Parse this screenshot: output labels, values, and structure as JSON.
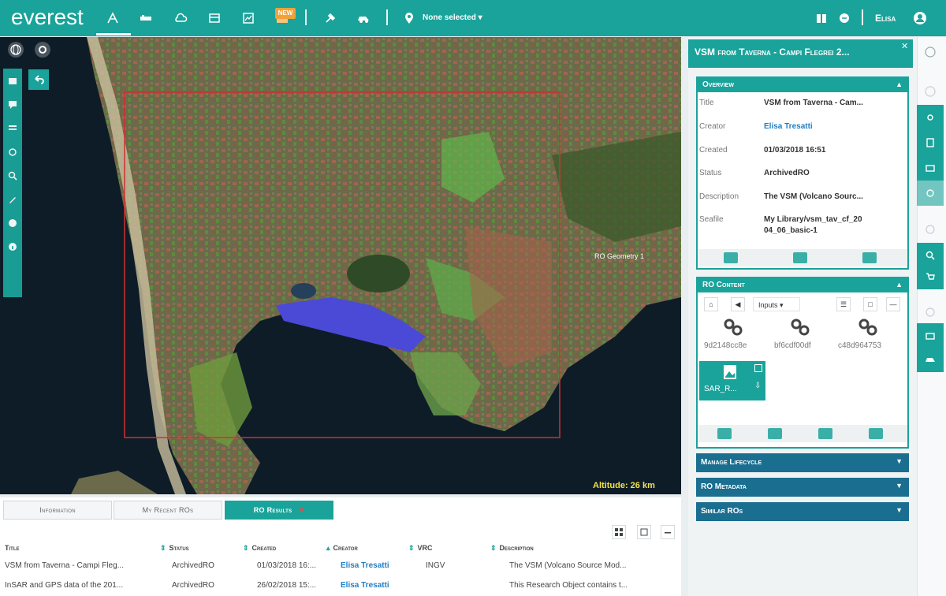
{
  "app": {
    "logo": "everest",
    "location_selector": "None selected",
    "user": "Elisa",
    "new_badge": "NEW"
  },
  "map": {
    "geometry_label": "RO Geometry 1",
    "altitude": "Altitude: 26 km"
  },
  "bottom": {
    "tabs": [
      {
        "label": "Information"
      },
      {
        "label": "My Recent ROs"
      },
      {
        "label": "RO Results",
        "close": "✕"
      }
    ],
    "columns": [
      "Title",
      "Status",
      "Created",
      "Creator",
      "VRC",
      "Description"
    ],
    "rows": [
      {
        "title": "VSM from Taverna - Campi Fleg...",
        "status": "ArchivedRO",
        "created": "01/03/2018 16:...",
        "creator": "Elisa Tresatti",
        "vrc": "INGV",
        "description": "The VSM (Volcano Source Mod..."
      },
      {
        "title": "InSAR and GPS data of the 201...",
        "status": "ArchivedRO",
        "created": "26/02/2018 15:...",
        "creator": "Elisa Tresatti",
        "vrc": "",
        "description": "This Research Object contains t..."
      }
    ]
  },
  "side": {
    "title": "VSM from Taverna - Campi Flegrei 2...",
    "close": "✕",
    "overview": {
      "header": "Overview",
      "fields": [
        {
          "label": "Title",
          "value": "VSM from Taverna - Cam..."
        },
        {
          "label": "Creator",
          "value": "Elisa Tresatti"
        },
        {
          "label": "Created",
          "value": "01/03/2018 16:51"
        },
        {
          "label": "Status",
          "value": "ArchivedRO"
        },
        {
          "label": "Description",
          "value": "The VSM (Volcano Sourc..."
        },
        {
          "label": "Seafile",
          "value": "My Library/vsm_tav_cf_20",
          "value2": "04_06_basic-1"
        }
      ]
    },
    "content": {
      "header": "RO Content",
      "inputs": "Inputs",
      "resources": [
        {
          "id": "9d2148cc8e"
        },
        {
          "id": "bf6cdf00df"
        },
        {
          "id": "c48d964753"
        }
      ],
      "sar_label": "SAR_R..."
    },
    "sections": [
      {
        "label": "Manage Lifecycle"
      },
      {
        "label": "RO Metadata"
      },
      {
        "label": "Similar ROs"
      }
    ]
  },
  "colors": {
    "teal": "#1aa39a",
    "navy": "#1a6e8f",
    "link": "#1f7fc6",
    "altitude": "#f4e34b"
  }
}
